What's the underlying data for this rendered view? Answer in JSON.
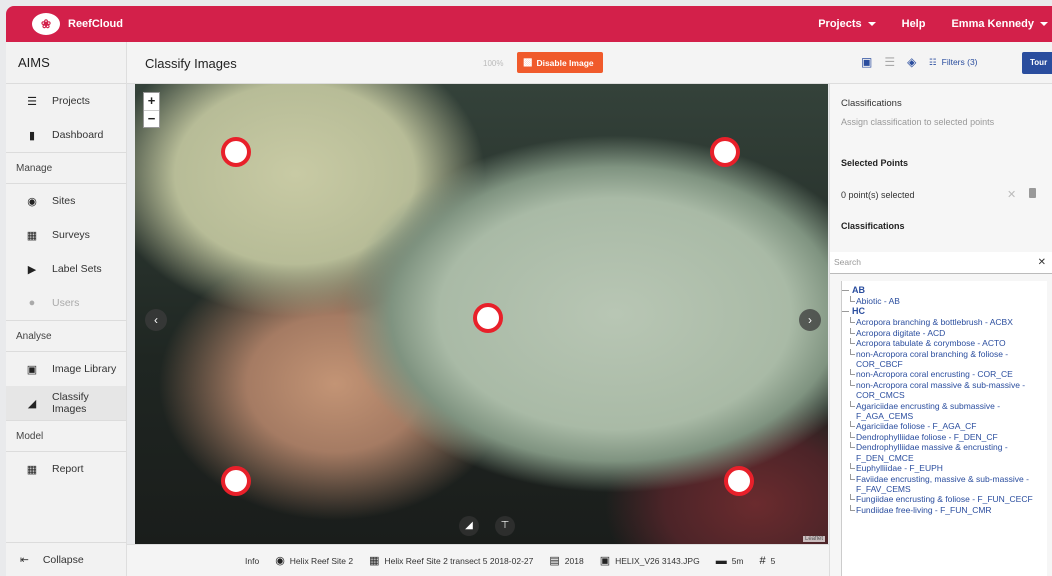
{
  "topbar": {
    "brand": "ReefCloud",
    "nav": [
      "Projects",
      "Help",
      "Emma Kennedy"
    ]
  },
  "sidebar": {
    "org": "AIMS",
    "items_top": [
      {
        "label": "Projects",
        "icon": "list-icon"
      },
      {
        "label": "Dashboard",
        "icon": "bar-chart-icon"
      }
    ],
    "section_manage": "Manage",
    "items_manage": [
      {
        "label": "Sites",
        "icon": "map-pin-icon"
      },
      {
        "label": "Surveys",
        "icon": "clipboard-icon"
      },
      {
        "label": "Label Sets",
        "icon": "label-icon"
      },
      {
        "label": "Users",
        "icon": "users-icon",
        "disabled": true
      }
    ],
    "section_analyse": "Analyse",
    "items_analyse": [
      {
        "label": "Image Library",
        "icon": "image-icon"
      },
      {
        "label": "Classify Images",
        "icon": "classify-icon",
        "active": true
      }
    ],
    "section_model": "Model",
    "items_model": [
      {
        "label": "Report",
        "icon": "report-icon"
      }
    ],
    "collapse": "Collapse"
  },
  "header": {
    "title": "Classify Images",
    "zoom": "100%",
    "disable_image": "Disable Image",
    "filters": "Filters (3)",
    "tour": "Tour"
  },
  "viewer": {
    "attribution": "Leaflet"
  },
  "infobar": {
    "label": "Info",
    "site": "Helix Reef Site 2",
    "survey": "Helix Reef Site 2 transect 5 2018-02-27",
    "year": "2018",
    "image": "HELIX_V26 3143.JPG",
    "depth": "5m",
    "points": "5"
  },
  "panel": {
    "title": "Classifications",
    "subtitle": "Assign classification to selected points",
    "selected_heading": "Selected Points",
    "selected_count": "0 point(s) selected",
    "classifications_heading": "Classifications",
    "search_placeholder": "Search",
    "groups": [
      {
        "code": "AB",
        "items": [
          "Abiotic - AB"
        ]
      },
      {
        "code": "HC",
        "items": [
          "Acropora branching & bottlebrush - ACBX",
          "Acropora digitate - ACD",
          "Acropora tabulate & corymbose - ACTO",
          "non-Acropora coral branching & foliose - COR_CBCF",
          "non-Acropora coral encrusting - COR_CE",
          "non-Acropora coral massive & sub-massive - COR_CMCS",
          "Agariciidae encrusting & submassive - F_AGA_CEMS",
          "Agariciidae foliose - F_AGA_CF",
          "Dendrophylliidae foliose - F_DEN_CF",
          "Dendrophylliidae massive & encrusting - F_DEN_CMCE",
          "Euphylliidae - F_EUPH",
          "Faviidae encrusting, massive & sub-massive - F_FAV_CEMS",
          "Fungiidae encrusting & foliose - F_FUN_CECF",
          "Fundiidae free-living - F_FUN_CMR"
        ]
      }
    ]
  }
}
